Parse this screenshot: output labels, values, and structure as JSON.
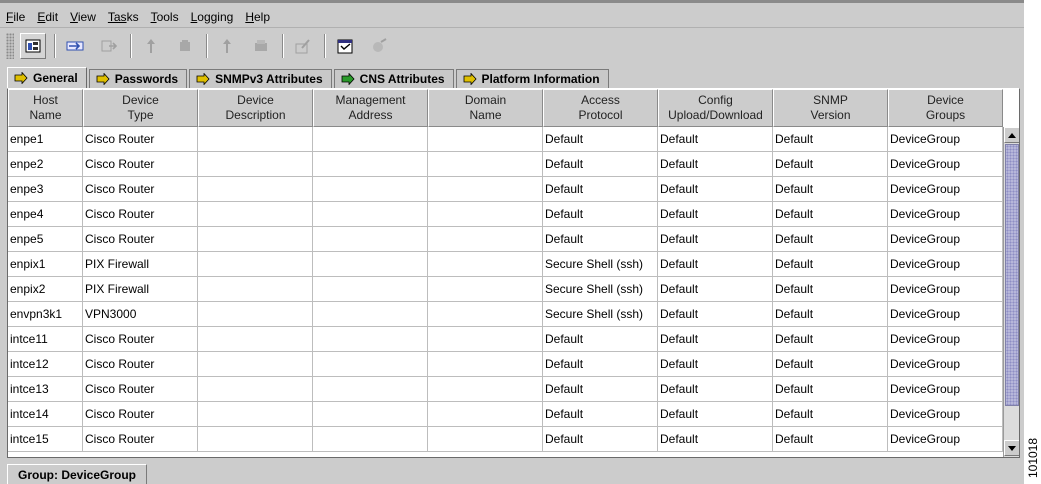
{
  "menubar": {
    "items": [
      {
        "label": "File",
        "mnemonic": "F",
        "rest": "ile"
      },
      {
        "label": "Edit",
        "mnemonic": "E",
        "rest": "dit"
      },
      {
        "label": "View",
        "mnemonic": "V",
        "rest": "iew"
      },
      {
        "label": "Tasks",
        "mnemonic": "Tas",
        "rest": "ks"
      },
      {
        "label": "Tools",
        "mnemonic": "T",
        "rest": "ools"
      },
      {
        "label": "Logging",
        "mnemonic": "L",
        "rest": "ogging"
      },
      {
        "label": "Help",
        "mnemonic": "H",
        "rest": "elp"
      }
    ]
  },
  "toolbar": {
    "buttons": [
      {
        "icon": "device-manager-icon",
        "enabled": true
      },
      {
        "icon": "import-icon",
        "enabled": true
      },
      {
        "icon": "export-icon",
        "enabled": false
      },
      {
        "icon": "upload-icon",
        "enabled": false
      },
      {
        "icon": "upload-group-icon",
        "enabled": false
      },
      {
        "icon": "deploy-icon",
        "enabled": false
      },
      {
        "icon": "deploy-group-icon",
        "enabled": false
      },
      {
        "icon": "edit-icon",
        "enabled": false
      },
      {
        "icon": "properties-icon",
        "enabled": true
      },
      {
        "icon": "discover-icon",
        "enabled": false
      }
    ]
  },
  "tabs": [
    {
      "label": "General",
      "active": true
    },
    {
      "label": "Passwords",
      "active": false
    },
    {
      "label": "SNMPv3 Attributes",
      "active": false
    },
    {
      "label": "CNS Attributes",
      "active": false
    },
    {
      "label": "Platform Information",
      "active": false
    }
  ],
  "table": {
    "columns": [
      {
        "line1": "Host",
        "line2": "Name"
      },
      {
        "line1": "Device",
        "line2": "Type"
      },
      {
        "line1": "Device",
        "line2": "Description"
      },
      {
        "line1": "Management",
        "line2": "Address"
      },
      {
        "line1": "Domain",
        "line2": "Name"
      },
      {
        "line1": "Access",
        "line2": "Protocol"
      },
      {
        "line1": "Config",
        "line2": "Upload/Download"
      },
      {
        "line1": "SNMP",
        "line2": "Version"
      },
      {
        "line1": "Device",
        "line2": "Groups"
      }
    ],
    "rows": [
      [
        "enpe1",
        "Cisco Router",
        "",
        "",
        "",
        "Default",
        "Default",
        "Default",
        "DeviceGroup"
      ],
      [
        "enpe2",
        "Cisco Router",
        "",
        "",
        "",
        "Default",
        "Default",
        "Default",
        "DeviceGroup"
      ],
      [
        "enpe3",
        "Cisco Router",
        "",
        "",
        "",
        "Default",
        "Default",
        "Default",
        "DeviceGroup"
      ],
      [
        "enpe4",
        "Cisco Router",
        "",
        "",
        "",
        "Default",
        "Default",
        "Default",
        "DeviceGroup"
      ],
      [
        "enpe5",
        "Cisco Router",
        "",
        "",
        "",
        "Default",
        "Default",
        "Default",
        "DeviceGroup"
      ],
      [
        "enpix1",
        "PIX Firewall",
        "",
        "",
        "",
        "Secure Shell (ssh)",
        "Default",
        "Default",
        "DeviceGroup"
      ],
      [
        "enpix2",
        "PIX Firewall",
        "",
        "",
        "",
        "Secure Shell (ssh)",
        "Default",
        "Default",
        "DeviceGroup"
      ],
      [
        "envpn3k1",
        "VPN3000",
        "",
        "",
        "",
        "Secure Shell (ssh)",
        "Default",
        "Default",
        "DeviceGroup"
      ],
      [
        "intce11",
        "Cisco Router",
        "",
        "",
        "",
        "Default",
        "Default",
        "Default",
        "DeviceGroup"
      ],
      [
        "intce12",
        "Cisco Router",
        "",
        "",
        "",
        "Default",
        "Default",
        "Default",
        "DeviceGroup"
      ],
      [
        "intce13",
        "Cisco Router",
        "",
        "",
        "",
        "Default",
        "Default",
        "Default",
        "DeviceGroup"
      ],
      [
        "intce14",
        "Cisco Router",
        "",
        "",
        "",
        "Default",
        "Default",
        "Default",
        "DeviceGroup"
      ],
      [
        "intce15",
        "Cisco Router",
        "",
        "",
        "",
        "Default",
        "Default",
        "Default",
        "DeviceGroup"
      ]
    ]
  },
  "statusbar": {
    "text": "Group: DeviceGroup"
  },
  "figure_id": "101018",
  "colors": {
    "tab_icon": "#e0c000",
    "tab_icon_green": "#2a9a2a",
    "scroll_thumb": "#b7b7da"
  }
}
